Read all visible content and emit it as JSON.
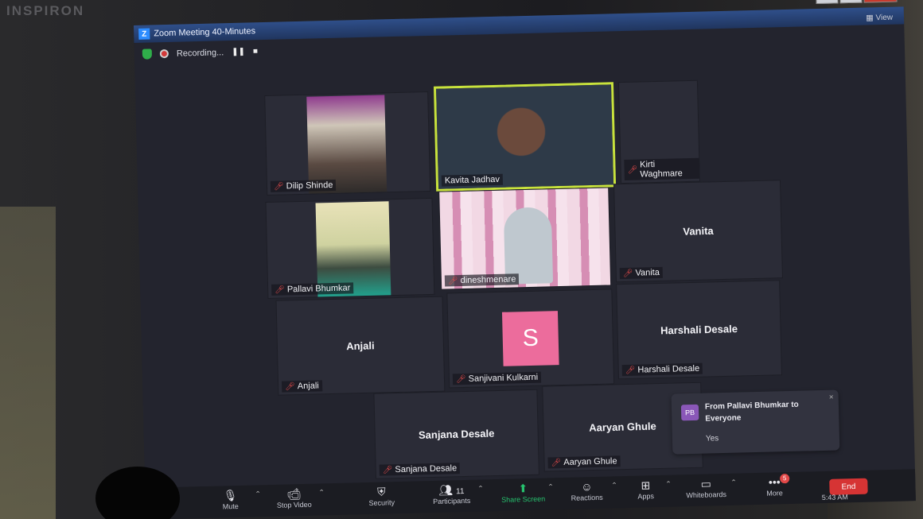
{
  "monitor": {
    "brand": "INSPIRON"
  },
  "window": {
    "title": "Zoom Meeting 40-Minutes",
    "view_label": "View",
    "controls": [
      "—",
      "❐",
      "✕"
    ]
  },
  "recording": {
    "status": "Recording...",
    "pause_icon": "pause-icon",
    "stop_icon": "stop-icon"
  },
  "participants": [
    {
      "name": "Dilip Shinde",
      "muted": true,
      "video": true
    },
    {
      "name": "Kavita Jadhav",
      "muted": false,
      "video": true,
      "active_speaker": true
    },
    {
      "name": "Kirti Waghmare",
      "muted": true,
      "video": false
    },
    {
      "name": "Pallavi Bhumkar",
      "muted": true,
      "video": true
    },
    {
      "name": "dineshmenare",
      "muted": true,
      "video": true
    },
    {
      "name": "Vanita",
      "display_name": "Vanita",
      "muted": true,
      "video": false
    },
    {
      "name": "Anjali",
      "display_name": "Anjali",
      "muted": true,
      "video": false
    },
    {
      "name": "Sanjivani Kulkarni",
      "avatar_letter": "S",
      "muted": true,
      "video": false
    },
    {
      "name": "Harshali Desale",
      "display_name": "Harshali Desale",
      "muted": true,
      "video": false
    },
    {
      "name": "Sanjana Desale",
      "display_name": "Sanjana Desale",
      "muted": true,
      "video": false
    },
    {
      "name": "Aaryan Ghule",
      "display_name": "Aaryan Ghule",
      "muted": true,
      "video": false
    }
  ],
  "chat_toast": {
    "initials": "PB",
    "from": "From Pallavi Bhumkar to Everyone",
    "message": "Yes",
    "close": "×"
  },
  "toolbar": {
    "mute": "Mute",
    "stop_video": "Stop Video",
    "security": "Security",
    "participants": "Participants",
    "participants_count": "11",
    "share_screen": "Share Screen",
    "reactions": "Reactions",
    "apps": "Apps",
    "whiteboards": "Whiteboards",
    "more": "More",
    "more_badge": "5",
    "end": "End"
  },
  "taskbar": {
    "time": "5:43 AM"
  },
  "colors": {
    "active_speaker_border": "#c8e23c",
    "share_green": "#26c26e",
    "end_red": "#d63434",
    "avatar_pink": "#ec6c9c"
  }
}
